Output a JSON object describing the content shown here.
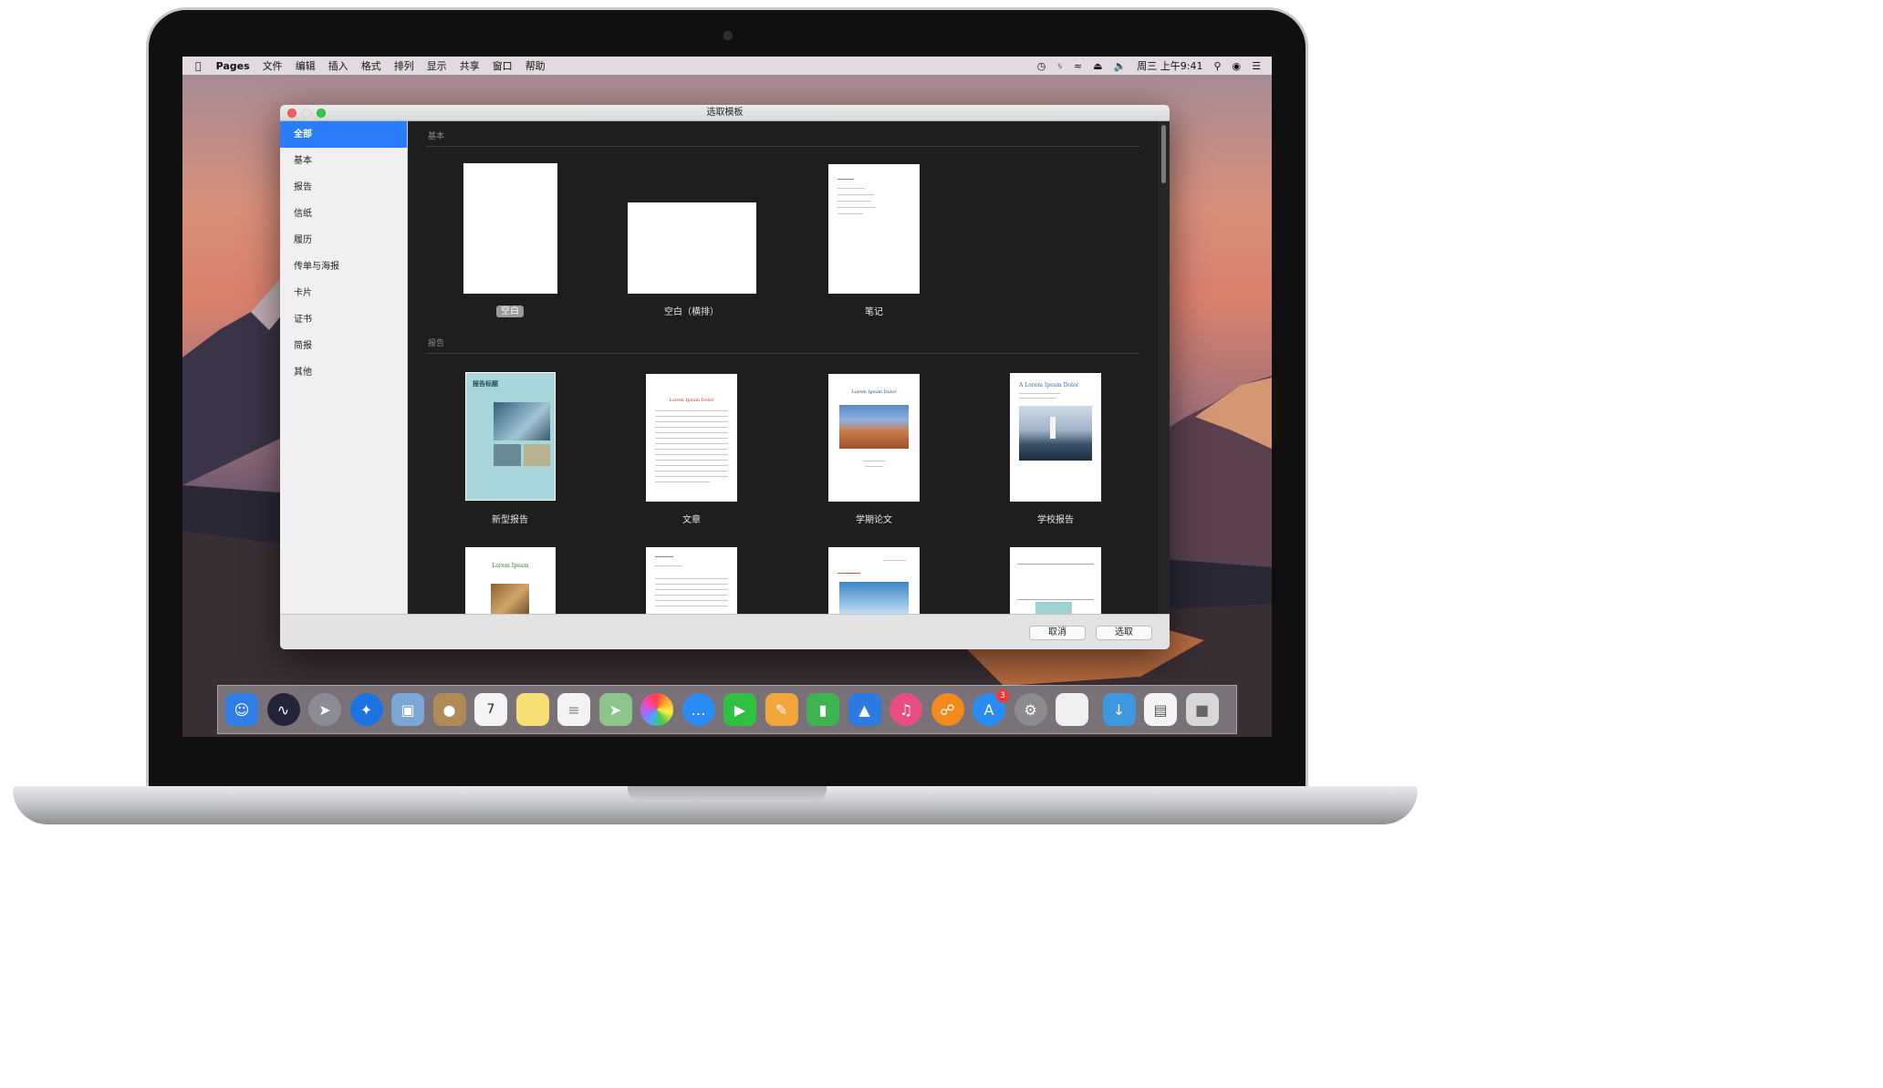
{
  "menubar": {
    "apple_icon": "apple-logo-icon",
    "app": "Pages",
    "menus": [
      "文件",
      "编辑",
      "插入",
      "格式",
      "排列",
      "显示",
      "共享",
      "窗口",
      "帮助"
    ],
    "status_icons": [
      "time-machine-icon",
      "bluetooth-icon",
      "wifi-icon",
      "eject-icon",
      "volume-icon"
    ],
    "clock": "周三 上午9:41",
    "right_icons": [
      "spotlight-search-icon",
      "siri-icon",
      "notification-center-icon"
    ]
  },
  "window": {
    "title": "选取模板",
    "sidebar": [
      "全部",
      "基本",
      "报告",
      "信纸",
      "履历",
      "传单与海报",
      "卡片",
      "证书",
      "简报",
      "其他"
    ],
    "selected_sidebar": "全部",
    "section_basic": "基本",
    "section_report": "报告",
    "basic_templates": [
      "空白",
      "空白（横排）",
      "笔记"
    ],
    "report_templates": [
      "新型报告",
      "文章",
      "学期论文",
      "学校报告"
    ],
    "thumb_text": {
      "report_title": "报告标题",
      "lorem": "Lorem Ipsum Dolor",
      "a_lorem": "A Lorem Ipsum Dolor",
      "lorem_ipsum": "Lorem Ipsum"
    },
    "cancel": "取消",
    "choose": "选取"
  },
  "dock": {
    "apps": [
      "finder-icon",
      "siri-icon",
      "launchpad-icon",
      "safari-icon",
      "photo-preview-icon",
      "contacts-icon",
      "calendar-icon",
      "notes-icon",
      "reminders-icon",
      "maps-icon",
      "photos-icon",
      "messages-icon",
      "facetime-icon",
      "pages-icon",
      "numbers-icon",
      "keynote-icon",
      "itunes-icon",
      "ibooks-icon",
      "app-store-icon",
      "system-preferences-icon",
      "textedit-icon"
    ],
    "calendar_day": "7",
    "app_store_badge": "3",
    "stacks": [
      "downloads-folder-icon",
      "documents-stack-icon",
      "trash-icon"
    ],
    "colors": {
      "finder": "#2f7ee6",
      "siri": "#23233a",
      "launchpad": "#8c8c96",
      "safari": "#1b74e2",
      "preview": "#7aa7d6",
      "contacts": "#b08a55",
      "calendar": "#f4f4f4",
      "notes": "#f6df72",
      "reminders": "#f3f3f3",
      "maps": "#8bc58a",
      "photos": "#f2f2f2",
      "messages": "#2a8cf3",
      "facetime": "#2fc142",
      "pages": "#f1a53a",
      "numbers": "#3fb34f",
      "keynote": "#2b7be0",
      "itunes": "#e94e83",
      "ibooks": "#f28a1c",
      "appstore": "#2a8cf3",
      "sysprefs": "#8c8c8f",
      "textedit": "#efefef",
      "downloads": "#3e98e0",
      "documents": "#f4f4f4",
      "trash": "#d7d7d7"
    }
  }
}
